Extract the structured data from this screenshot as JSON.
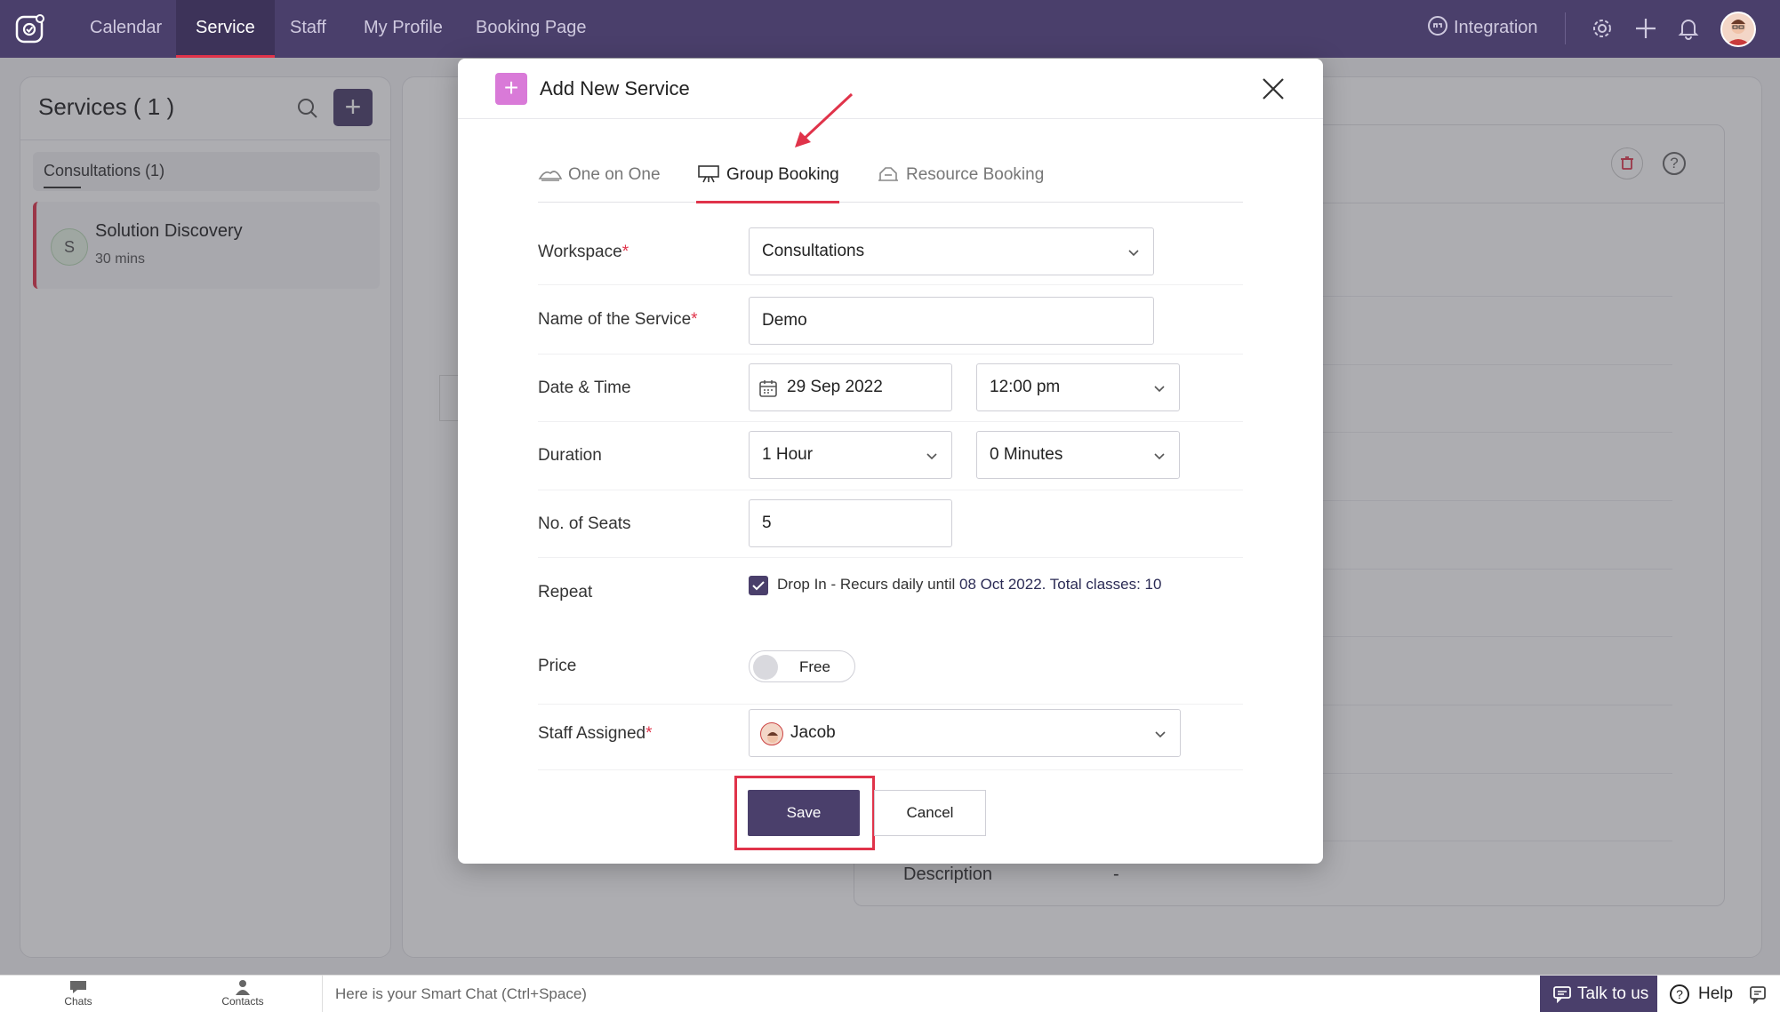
{
  "nav": {
    "items": [
      {
        "label": "Calendar"
      },
      {
        "label": "Service"
      },
      {
        "label": "Staff"
      },
      {
        "label": "My Profile"
      },
      {
        "label": "Booking Page"
      }
    ],
    "active": "Service",
    "integration_label": "Integration"
  },
  "sidebar": {
    "title": "Services ( 1 )",
    "group_label": "Consultations (1)",
    "item": {
      "initial": "S",
      "name": "Solution Discovery",
      "duration": "30 mins"
    }
  },
  "detail": {
    "description_label": "Description",
    "description_value": "-"
  },
  "modal": {
    "title": "Add New Service",
    "tabs": [
      {
        "label": "One on One"
      },
      {
        "label": "Group Booking"
      },
      {
        "label": "Resource Booking"
      }
    ],
    "active_tab": "Group Booking",
    "fields": {
      "workspace": {
        "label": "Workspace",
        "value": "Consultations",
        "required": true
      },
      "service_name": {
        "label": "Name of the Service",
        "value": "Demo",
        "required": true
      },
      "date_time": {
        "label": "Date & Time",
        "date": "29 Sep 2022",
        "time": "12:00 pm"
      },
      "duration": {
        "label": "Duration",
        "hours": "1 Hour",
        "minutes": "0 Minutes"
      },
      "seats": {
        "label": "No. of Seats",
        "value": "5"
      },
      "repeat": {
        "label": "Repeat",
        "checked": true,
        "text_prefix": "Drop In - Recurs daily until ",
        "text_date": "08 Oct 2022",
        "text_suffix": ". Total classes: 10"
      },
      "price": {
        "label": "Price",
        "toggle_label": "Free"
      },
      "staff": {
        "label": "Staff Assigned",
        "value": "Jacob",
        "required": true
      }
    },
    "required_mark": "*",
    "save_label": "Save",
    "cancel_label": "Cancel"
  },
  "bottom": {
    "chats_label": "Chats",
    "contacts_label": "Contacts",
    "smartchat_placeholder": "Here is your Smart Chat (Ctrl+Space)",
    "talk_label": "Talk to us",
    "help_label": "Help"
  },
  "colors": {
    "nav_bg": "#4a3f6b",
    "accent": "#e0334a",
    "primary_button": "#4a3f6b",
    "modal_icon": "#d97ad8"
  }
}
